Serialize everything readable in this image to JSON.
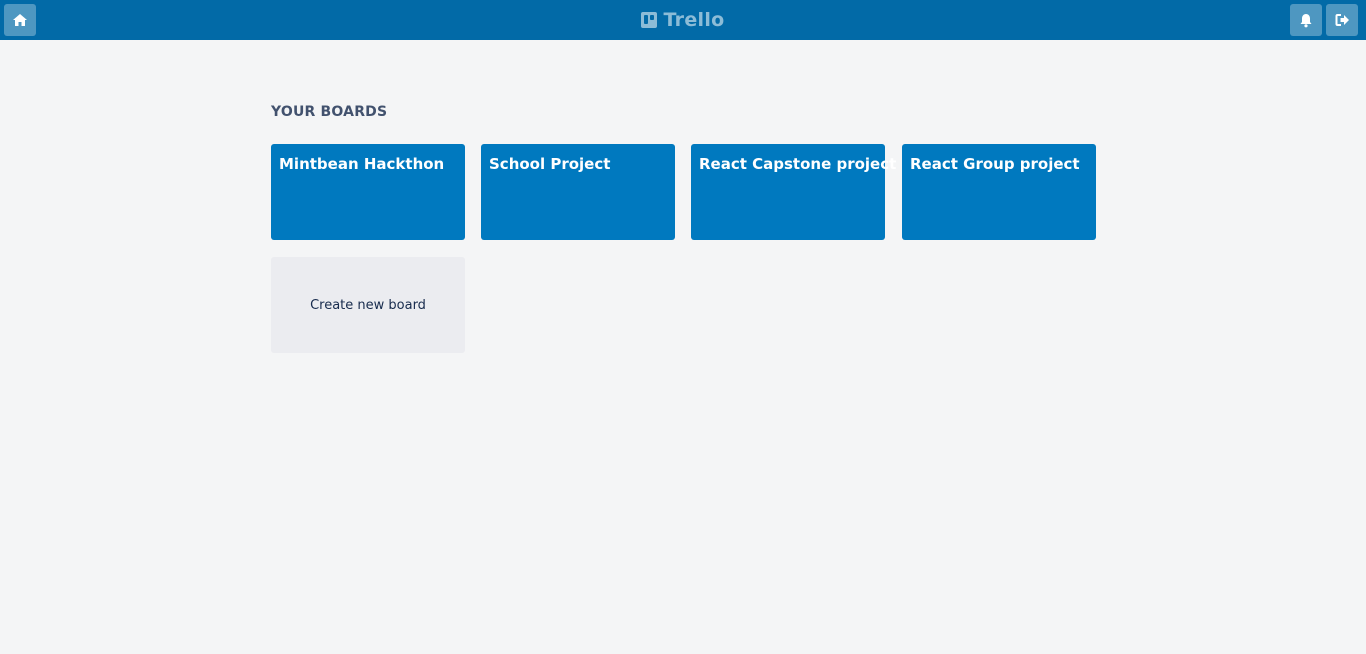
{
  "header": {
    "app_name": "Trello",
    "home_icon": "home-icon",
    "notification_icon": "bell-icon",
    "logout_icon": "logout-icon",
    "bar_color": "#026aa7"
  },
  "boards_section": {
    "title": "YOUR BOARDS",
    "boards": [
      {
        "title": "Mintbean Hackthon",
        "color": "#0079bf"
      },
      {
        "title": "School Project",
        "color": "#0079bf"
      },
      {
        "title": "React Capstone project",
        "color": "#0079bf"
      },
      {
        "title": "React Group project",
        "color": "#0079bf"
      }
    ],
    "create_label": "Create new board"
  }
}
